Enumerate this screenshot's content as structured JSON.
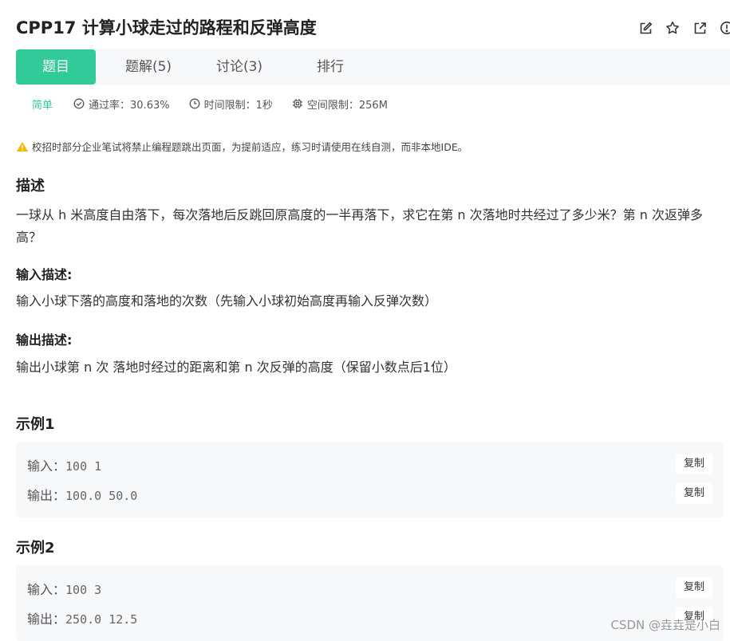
{
  "problem": {
    "title": "CPP17  计算小球走过的路程和反弹高度"
  },
  "title_actions": [
    {
      "icon": "edit-icon"
    },
    {
      "icon": "star-icon"
    },
    {
      "icon": "external-link-icon"
    },
    {
      "icon": "help-icon"
    }
  ],
  "tabs": [
    {
      "label": "题目",
      "active": true
    },
    {
      "label": "题解(5)",
      "active": false
    },
    {
      "label": "讨论(3)",
      "active": false
    },
    {
      "label": "排行",
      "active": false
    }
  ],
  "meta": {
    "difficulty": "简单",
    "pass_rate": "通过率：30.63%",
    "time_limit": "时间限制：1秒",
    "memory_limit": "空间限制：256M"
  },
  "notice": "校招时部分企业笔试将禁止编程题跳出页面，为提前适应，练习时请使用在线自测，而非本地IDE。",
  "description": {
    "heading": "描述",
    "text": "一球从 h 米高度自由落下，每次落地后反跳回原高度的一半再落下，求它在第 n 次落地时共经过了多少米？第 n 次返弹多高？"
  },
  "input_desc": {
    "heading": "输入描述:",
    "text": "输入小球下落的高度和落地的次数（先输入小球初始高度再输入反弹次数）"
  },
  "output_desc": {
    "heading": "输出描述:",
    "text": "输出小球第 n 次 落地时经过的距离和第 n 次反弹的高度（保留小数点后1位）"
  },
  "examples": [
    {
      "heading": "示例1",
      "input_label": "输入：",
      "input_value": "100 1",
      "output_label": "输出：",
      "output_value": "100.0 50.0",
      "copy_label": "复制"
    },
    {
      "heading": "示例2",
      "input_label": "输入：",
      "input_value": "100 3",
      "output_label": "输出：",
      "output_value": "250.0 12.5",
      "copy_label": "复制"
    }
  ],
  "watermark": "CSDN @垚垚是小白",
  "colors": {
    "accent": "#32ca99",
    "warning": "#f5b800",
    "panel_bg": "#f7f8fa"
  }
}
